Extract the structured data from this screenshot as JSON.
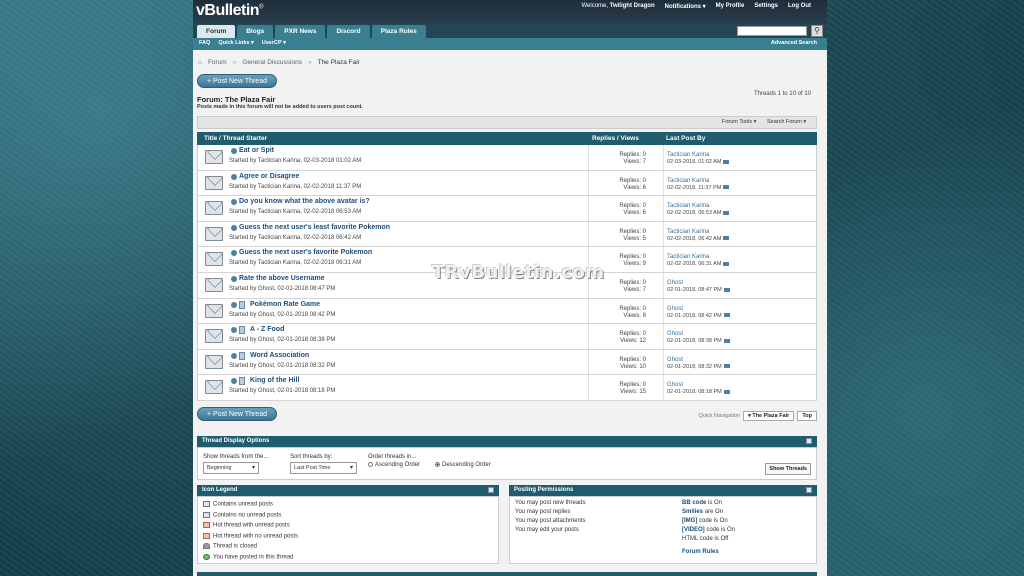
{
  "header": {
    "logo": "vBulletin",
    "logo_mark": "®",
    "toplinks": {
      "welcome_prefix": "Welcome,",
      "username": "Twilight Dragon",
      "notifications": "Notifications ▾",
      "my_profile": "My Profile",
      "settings": "Settings",
      "logout": "Log Out"
    }
  },
  "navtabs": [
    "Forum",
    "Blogs",
    "PXR News",
    "Discord",
    "Plaza Rules"
  ],
  "subnav": {
    "faq": "FAQ",
    "quick_links": "Quick Links ▾",
    "usercp": "UserCP ▾",
    "advanced_search": "Advanced Search"
  },
  "breadcrumb": [
    "Forum",
    "General Discussions",
    "The Plaza Fair"
  ],
  "post_new_thread": "+ Post New Thread",
  "forum": {
    "title": "Forum: The Plaza Fair",
    "subtitle": "Posts made in this forum will not be added to users post count.",
    "thread_count": "Threads 1 to 10 of 10",
    "forum_tools": "Forum Tools ▾",
    "search_forum": "Search Forum ▾"
  },
  "table_headers": {
    "title": "Title / Thread Starter",
    "replies": "Replies / Views",
    "lastpost": "Last Post By"
  },
  "threads": [
    {
      "title": "Eat or Spit",
      "started": "Started by Tactician Karina, 02-03-2018 01:02 AM",
      "replies": "Replies: 0",
      "views": "Views: 7",
      "lp_user": "Tactician Karina",
      "lp_date": "02-03-2018, 01:02 AM"
    },
    {
      "title": "Agree or Disagree",
      "started": "Started by Tactician Karina, 02-02-2018 11:37 PM",
      "replies": "Replies: 0",
      "views": "Views: 6",
      "lp_user": "Tactician Karina",
      "lp_date": "02-02-2018, 11:37 PM"
    },
    {
      "title": "Do you know what the above avatar is?",
      "started": "Started by Tactician Karina, 02-02-2018 06:53 AM",
      "replies": "Replies: 0",
      "views": "Views: 6",
      "lp_user": "Tactician Karina",
      "lp_date": "02-02-2018, 06:53 AM"
    },
    {
      "title": "Guess the next user's least favorite Pokemon",
      "started": "Started by Tactician Karina, 02-02-2018 06:42 AM",
      "replies": "Replies: 0",
      "views": "Views: 5",
      "lp_user": "Tactician Karina",
      "lp_date": "02-02-2018, 06:42 AM"
    },
    {
      "title": "Guess the next user's favorite Pokemon",
      "started": "Started by Tactician Karina, 02-02-2018 06:31 AM",
      "replies": "Replies: 0",
      "views": "Views: 9",
      "lp_user": "Tactician Karina",
      "lp_date": "02-02-2018, 06:31 AM"
    },
    {
      "title": "Rate the above Username",
      "started": "Started by Ghost, 02-01-2018 08:47 PM",
      "replies": "Replies: 0",
      "views": "Views: 7",
      "lp_user": "Ghost",
      "lp_date": "02-01-2018, 08:47 PM"
    },
    {
      "title": "Pokémon Rate Game",
      "started": "Started by Ghost, 02-01-2018 08:42 PM",
      "replies": "Replies: 0",
      "views": "Views: 8",
      "lp_user": "Ghost",
      "lp_date": "02-01-2018, 08:42 PM"
    },
    {
      "title": "A - Z Food",
      "started": "Started by Ghost, 02-01-2018 08:38 PM",
      "replies": "Replies: 0",
      "views": "Views: 12",
      "lp_user": "Ghost",
      "lp_date": "02-01-2018, 08:38 PM"
    },
    {
      "title": "Word Association",
      "started": "Started by Ghost, 02-01-2018 08:32 PM",
      "replies": "Replies: 0",
      "views": "Views: 10",
      "lp_user": "Ghost",
      "lp_date": "02-01-2018, 08:32 PM"
    },
    {
      "title": "King of the Hill",
      "started": "Started by Ghost, 02-01-2018 08:18 PM",
      "replies": "Replies: 0",
      "views": "Views: 15",
      "lp_user": "Ghost",
      "lp_date": "02-01-2018, 08:18 PM"
    }
  ],
  "quick_nav": {
    "label": "Quick Navigation",
    "forum_select": "▾  The Plaza Fair",
    "top": "Top"
  },
  "display_options": {
    "title": "Thread Display Options",
    "show_from_label": "Show threads from the...",
    "show_from_value": "Beginning",
    "sort_label": "Sort threads by:",
    "sort_value": "Last Post Time",
    "order_label": "Order threads in...",
    "asc": "Ascending Order",
    "desc": "Descending Order",
    "show_button": "Show Threads"
  },
  "icon_legend": {
    "title": "Icon Legend",
    "items": [
      "Contains unread posts",
      "Contains no unread posts",
      "Hot thread with unread posts",
      "Hot thread with no unread posts",
      "Thread is closed",
      "You have posted in this thread"
    ]
  },
  "posting_permissions": {
    "title": "Posting Permissions",
    "rules": [
      "You may post new threads",
      "You may post replies",
      "You may post attachments",
      "You may edit your posts"
    ],
    "codes": [
      {
        "name": "BB code",
        "state": "is On"
      },
      {
        "name": "Smilies",
        "state": "are On"
      },
      {
        "name": "[IMG]",
        "state": "code is On"
      },
      {
        "name": "[VIDEO]",
        "state": "code is On"
      }
    ],
    "html_code": "HTML code is Off",
    "forum_rules": "Forum Rules"
  },
  "watermark": "TRvBulletin.com",
  "colors": {
    "nav_dark": "#244654",
    "nav_teal": "#3a7f8f",
    "table_head": "#1f5c6e",
    "link": "#1d4e7a"
  }
}
